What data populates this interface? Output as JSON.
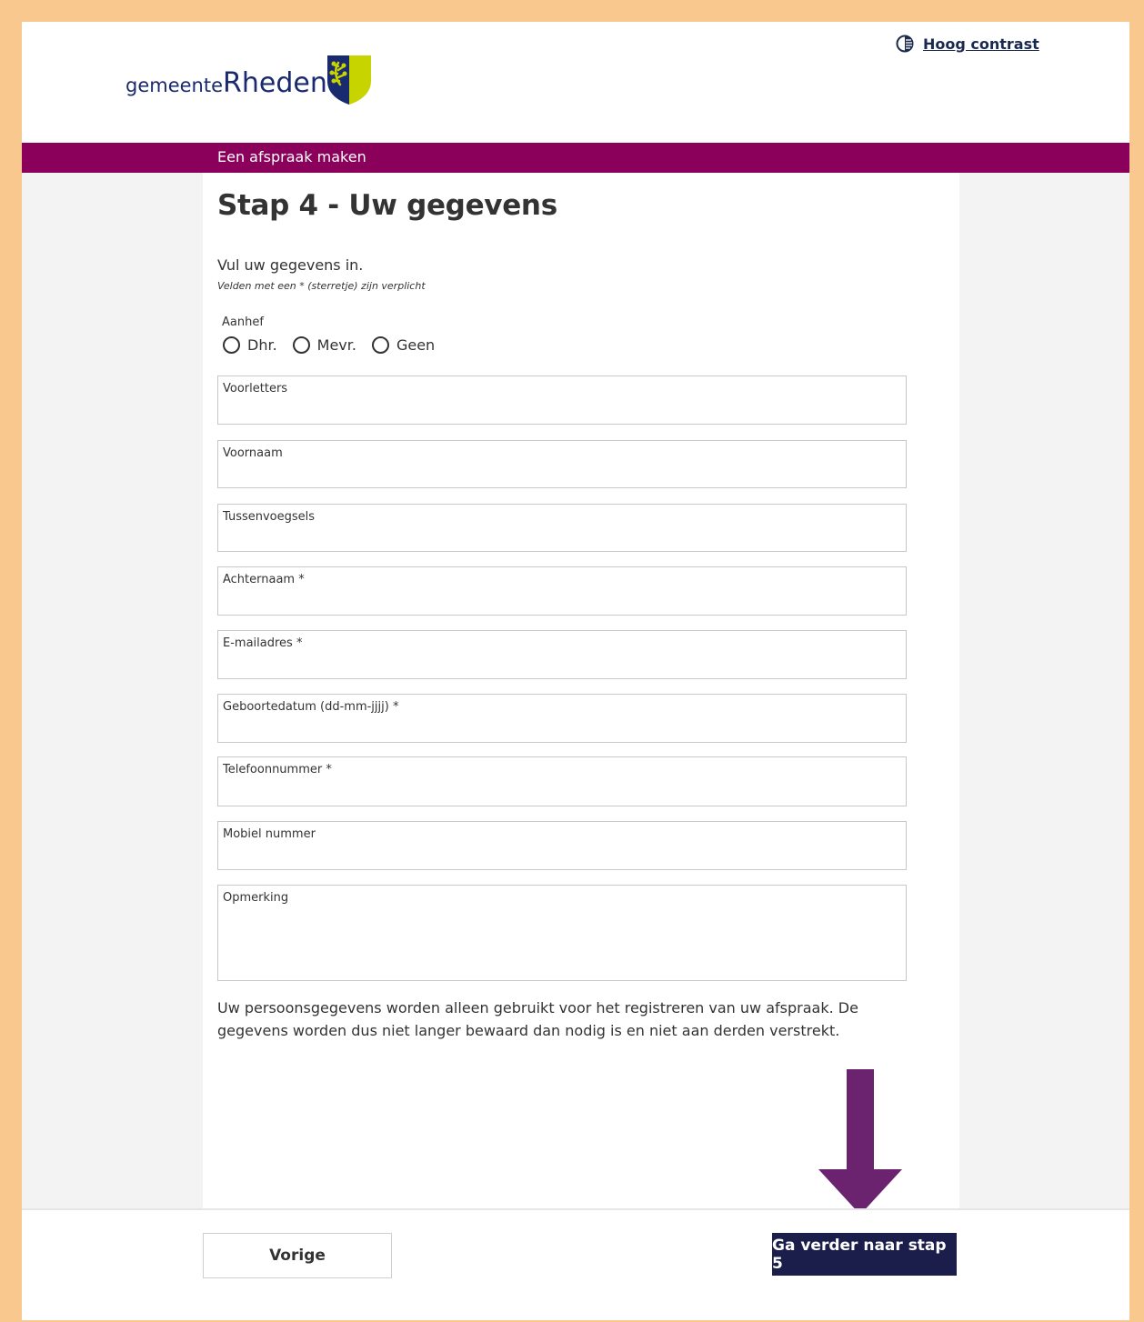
{
  "header": {
    "logo_prefix": "gemeente",
    "logo_name": "Rheden",
    "contrast_label": "Hoog contrast",
    "contrast_icon": "contrast-icon"
  },
  "banner": {
    "title": "Een afspraak maken"
  },
  "form": {
    "heading": "Stap 4 - Uw gegevens",
    "intro": "Vul uw gegevens in.",
    "required_note": "Velden met een * (sterretje) zijn verplicht",
    "salutation": {
      "label": "Aanhef",
      "options": [
        "Dhr.",
        "Mevr.",
        "Geen"
      ]
    },
    "fields": {
      "voorletters": "Voorletters",
      "voornaam": "Voornaam",
      "tussenvoegsels": "Tussenvoegsels",
      "achternaam": "Achternaam *",
      "email": "E-mailadres *",
      "geboortedatum": "Geboortedatum (dd-mm-jjjj) *",
      "telefoon": "Telefoonnummer *",
      "mobiel": "Mobiel nummer",
      "opmerking": "Opmerking"
    },
    "privacy": "Uw persoonsgegevens worden alleen gebruikt voor het registreren van uw afspraak. De gegevens worden dus niet langer bewaard dan nodig is en niet aan derden verstrekt."
  },
  "footer": {
    "prev_label": "Vorige",
    "next_label": "Ga verder naar stap 5"
  },
  "colors": {
    "banner": "#8b005a",
    "primary_button": "#1b1e4b",
    "arrow": "#6b2370",
    "outer_border": "#f8c88e"
  }
}
